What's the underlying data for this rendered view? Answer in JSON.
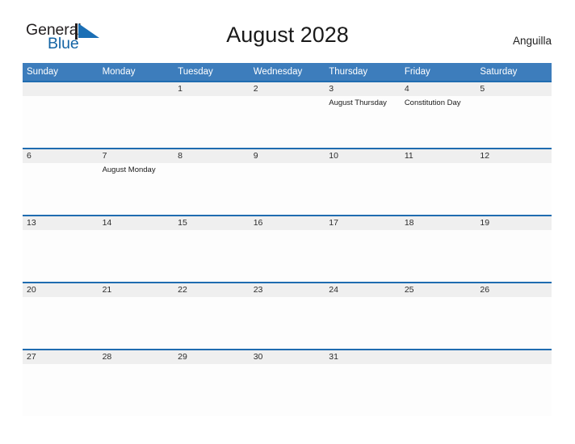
{
  "brand": {
    "name_line1": "General",
    "name_line2": "Blue",
    "mark": "triangle-logo-icon",
    "color_dark": "#231f20",
    "color_blue": "#1464a5"
  },
  "header": {
    "title": "August 2028",
    "location": "Anguilla"
  },
  "theme": {
    "header_blue": "#3d7dbc",
    "row_rule_blue": "#1f6cb0",
    "daynum_band": "#efefef",
    "cell_bg": "#fdfdfd"
  },
  "calendar": {
    "weekday_headers": [
      "Sunday",
      "Monday",
      "Tuesday",
      "Wednesday",
      "Thursday",
      "Friday",
      "Saturday"
    ],
    "weeks": [
      [
        {
          "day": "",
          "events": []
        },
        {
          "day": "",
          "events": []
        },
        {
          "day": "1",
          "events": []
        },
        {
          "day": "2",
          "events": []
        },
        {
          "day": "3",
          "events": [
            "August Thursday"
          ]
        },
        {
          "day": "4",
          "events": [
            "Constitution Day"
          ]
        },
        {
          "day": "5",
          "events": []
        }
      ],
      [
        {
          "day": "6",
          "events": []
        },
        {
          "day": "7",
          "events": [
            "August Monday"
          ]
        },
        {
          "day": "8",
          "events": []
        },
        {
          "day": "9",
          "events": []
        },
        {
          "day": "10",
          "events": []
        },
        {
          "day": "11",
          "events": []
        },
        {
          "day": "12",
          "events": []
        }
      ],
      [
        {
          "day": "13",
          "events": []
        },
        {
          "day": "14",
          "events": []
        },
        {
          "day": "15",
          "events": []
        },
        {
          "day": "16",
          "events": []
        },
        {
          "day": "17",
          "events": []
        },
        {
          "day": "18",
          "events": []
        },
        {
          "day": "19",
          "events": []
        }
      ],
      [
        {
          "day": "20",
          "events": []
        },
        {
          "day": "21",
          "events": []
        },
        {
          "day": "22",
          "events": []
        },
        {
          "day": "23",
          "events": []
        },
        {
          "day": "24",
          "events": []
        },
        {
          "day": "25",
          "events": []
        },
        {
          "day": "26",
          "events": []
        }
      ],
      [
        {
          "day": "27",
          "events": []
        },
        {
          "day": "28",
          "events": []
        },
        {
          "day": "29",
          "events": []
        },
        {
          "day": "30",
          "events": []
        },
        {
          "day": "31",
          "events": []
        },
        {
          "day": "",
          "events": []
        },
        {
          "day": "",
          "events": []
        }
      ]
    ]
  }
}
